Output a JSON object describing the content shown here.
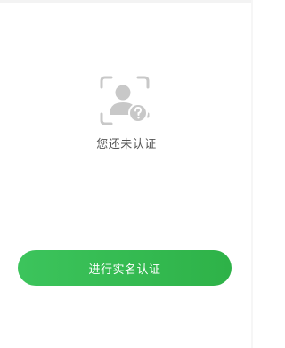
{
  "status": {
    "message": "您还未认证",
    "icon": "unverified-person-icon"
  },
  "action": {
    "verify_label": "进行实名认证"
  },
  "colors": {
    "button_start": "#3cc45c",
    "button_end": "#2eb248",
    "icon_gray": "#c8c8c8",
    "text_gray": "#555555"
  }
}
